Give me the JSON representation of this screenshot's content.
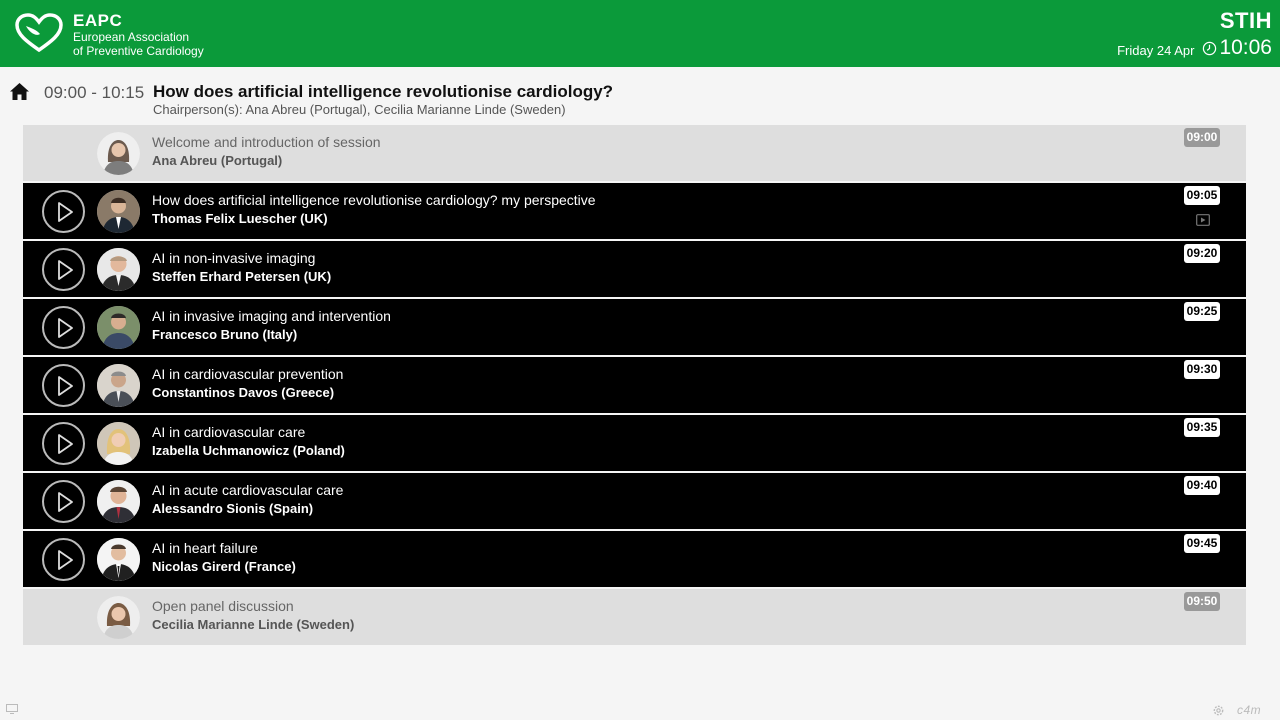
{
  "header": {
    "logo_abbr": "EAPC",
    "logo_line1": "European Association",
    "logo_line2": "of Preventive Cardiology",
    "location": "STIH",
    "date": "Friday 24 Apr",
    "time": "10:06",
    "brand_color": "#0b9a3a"
  },
  "session": {
    "time_range": "09:00 - 10:15",
    "title": "How does artificial intelligence revolutionise cardiology?",
    "chairpersons": "Chairperson(s): Ana Abreu (Portugal), Cecilia Marianne Linde (Sweden)"
  },
  "talks": [
    {
      "title": "Welcome and introduction of session",
      "speaker": "Ana Abreu (Portugal)",
      "time": "09:00",
      "style": "gray",
      "playable": false,
      "has_video": false
    },
    {
      "title": "How does artificial intelligence revolutionise cardiology? my perspective",
      "speaker": "Thomas Felix Luescher (UK)",
      "time": "09:05",
      "style": "dark",
      "playable": true,
      "has_video": true
    },
    {
      "title": "AI in non-invasive imaging",
      "speaker": "Steffen Erhard Petersen (UK)",
      "time": "09:20",
      "style": "dark",
      "playable": true,
      "has_video": false
    },
    {
      "title": "AI in invasive imaging and intervention",
      "speaker": "Francesco Bruno (Italy)",
      "time": "09:25",
      "style": "dark",
      "playable": true,
      "has_video": false
    },
    {
      "title": "AI in cardiovascular prevention",
      "speaker": "Constantinos Davos (Greece)",
      "time": "09:30",
      "style": "dark",
      "playable": true,
      "has_video": false
    },
    {
      "title": "AI in cardiovascular care",
      "speaker": "Izabella Uchmanowicz (Poland)",
      "time": "09:35",
      "style": "dark",
      "playable": true,
      "has_video": false
    },
    {
      "title": "AI in acute cardiovascular care",
      "speaker": "Alessandro Sionis (Spain)",
      "time": "09:40",
      "style": "dark",
      "playable": true,
      "has_video": false
    },
    {
      "title": "AI in heart failure",
      "speaker": "Nicolas Girerd (France)",
      "time": "09:45",
      "style": "dark",
      "playable": true,
      "has_video": false
    },
    {
      "title": "Open panel discussion",
      "speaker": "Cecilia Marianne Linde (Sweden)",
      "time": "09:50",
      "style": "gray",
      "playable": false,
      "has_video": false
    }
  ],
  "footer": {
    "brand": "c4m"
  },
  "icons": {
    "home": "home-icon",
    "clock": "clock-icon",
    "play": "play-icon",
    "video": "video-icon",
    "settings": "gear-icon",
    "screen": "screen-icon"
  }
}
